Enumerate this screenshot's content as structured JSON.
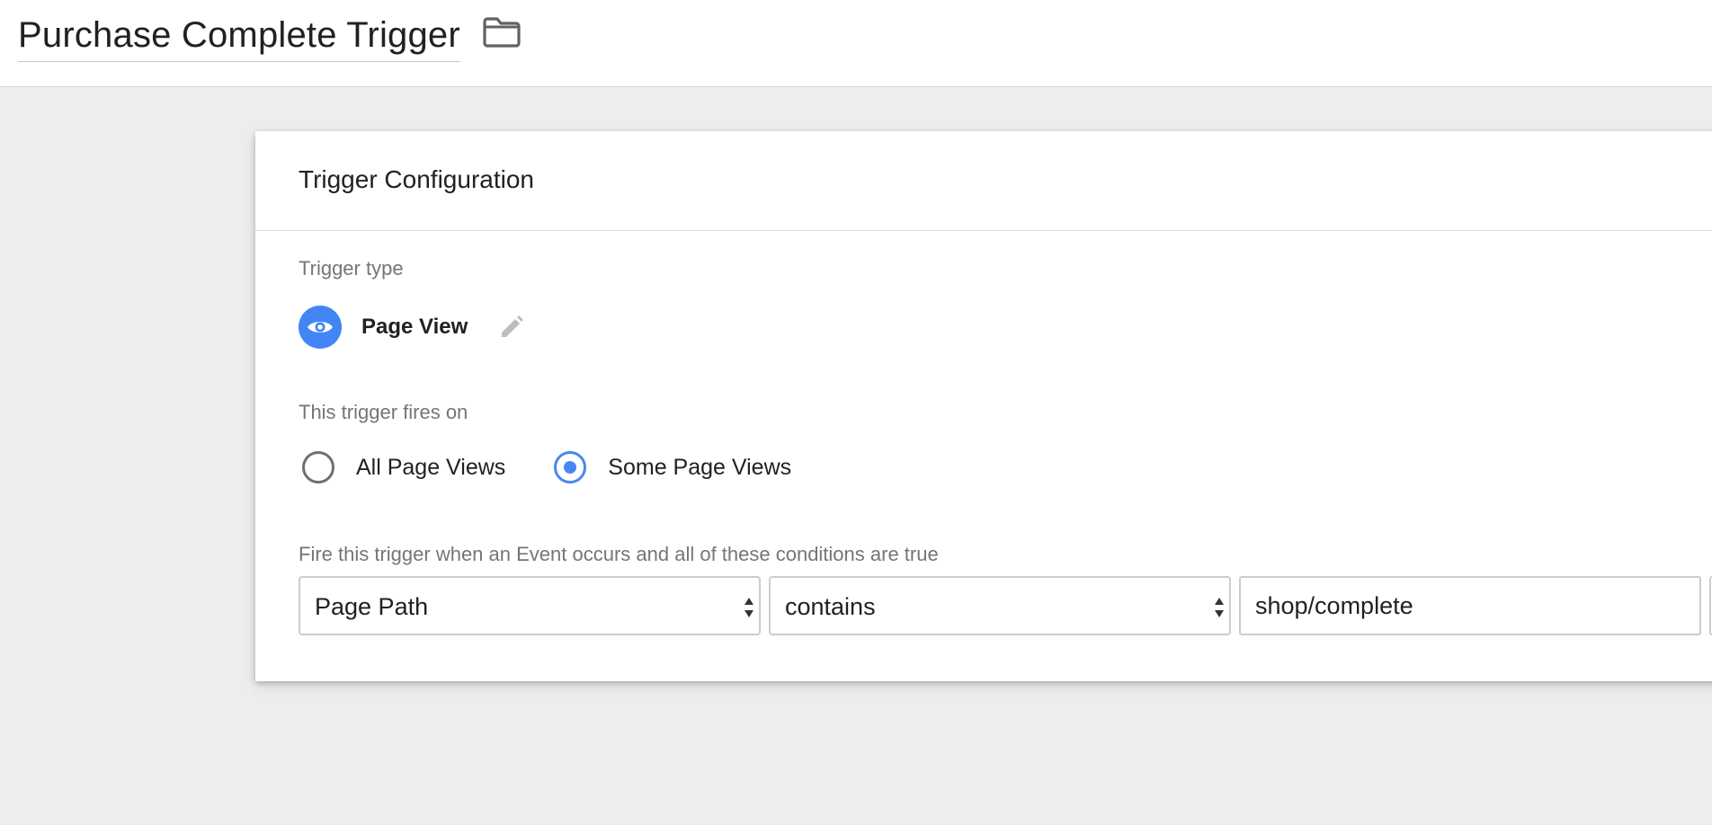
{
  "header": {
    "title": "Purchase Complete Trigger",
    "folder_icon": "folder-icon"
  },
  "card": {
    "title": "Trigger Configuration",
    "trigger_type_label": "Trigger type",
    "trigger_type": {
      "name": "Page View",
      "icon": "eye-icon",
      "icon_color": "#4285f4",
      "edit_icon": "pencil-icon"
    },
    "fires_on_label": "This trigger fires on",
    "fires_on_options": [
      {
        "label": "All Page Views",
        "selected": false
      },
      {
        "label": "Some Page Views",
        "selected": true
      }
    ],
    "accent_color": "#4a86f0",
    "conditions_label": "Fire this trigger when an Event occurs and all of these conditions are true",
    "condition": {
      "variable": "Page Path",
      "operator": "contains",
      "value": "shop/complete"
    }
  }
}
